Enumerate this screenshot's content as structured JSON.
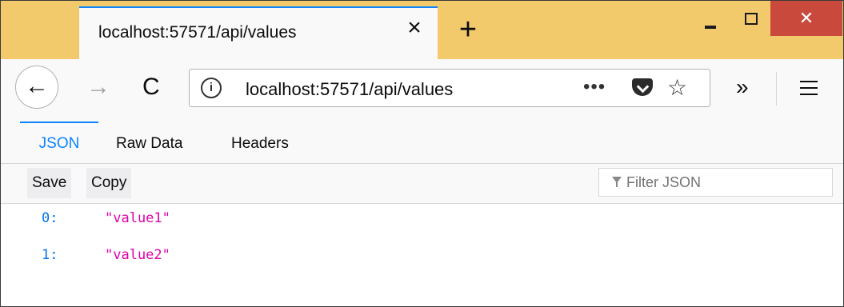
{
  "browser": {
    "tab_title": "localhost:57571/api/values",
    "tab_close": "×",
    "new_tab": "+",
    "window_close": "✕",
    "url": "localhost:57571/api/values",
    "back": "←",
    "forward": "→",
    "reload": "C",
    "page_actions": "•••",
    "bookmark": "☆",
    "overflow": "»",
    "info": "i"
  },
  "viewer": {
    "tabs": [
      "JSON",
      "Raw Data",
      "Headers"
    ],
    "active_tab": "JSON",
    "toolbar": {
      "save_label": "Save",
      "copy_label": "Copy"
    },
    "filter_placeholder": "Filter JSON",
    "rows": [
      {
        "key": "0:",
        "value": "\"value1\""
      },
      {
        "key": "1:",
        "value": "\"value2\""
      }
    ]
  },
  "colors": {
    "titlebar": "#f2c96b",
    "accent": "#0a84ff",
    "json_key": "#0074e8",
    "json_string": "#dd00a9",
    "close_button": "#c94a3c"
  }
}
